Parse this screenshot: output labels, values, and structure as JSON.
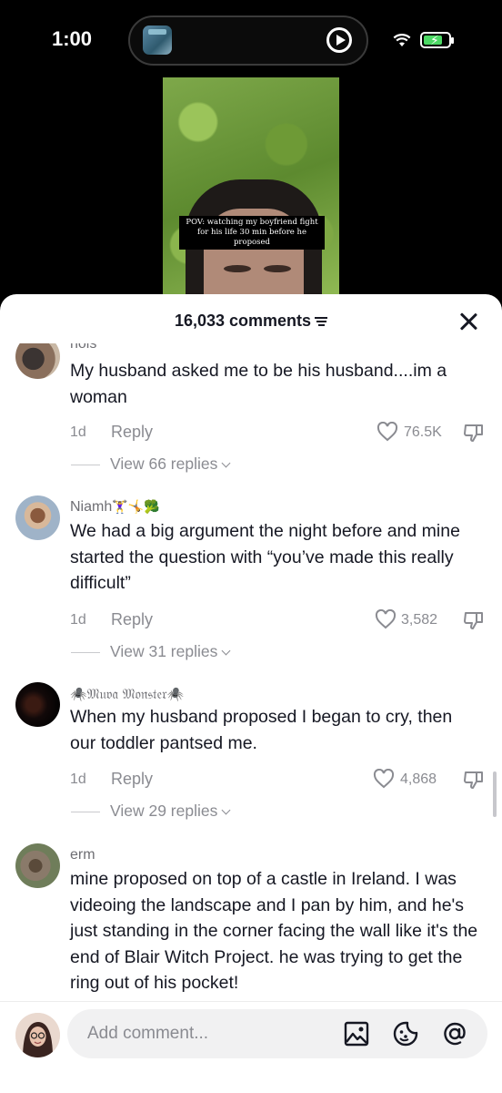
{
  "status_bar": {
    "time": "1:00"
  },
  "video": {
    "caption": "POV: watching my boyfriend fight for his life 30 min before he proposed"
  },
  "comments_panel": {
    "count_label": "16,033 comments",
    "comments": [
      {
        "username": "nols",
        "text": "My husband asked me to be his husband....im a woman",
        "date": "1d",
        "reply_label": "Reply",
        "likes": "76.5K",
        "view_replies": "View 66 replies"
      },
      {
        "username": "Niamh",
        "username_emoji": "🏋️‍♀️🤸🥦",
        "text": "We had a big argument the night before and mine started the question with “you’ve made this really difficult”",
        "date": "1d",
        "reply_label": "Reply",
        "likes": "3,582",
        "view_replies": "View 31 replies"
      },
      {
        "username": "🕷️𝔐𝔲𝔳𝔞 𝔐𝔬𝔫𝔰𝔱𝔢𝔯🕷️",
        "text": "When my husband proposed I began to cry, then our toddler pantsed me.",
        "date": "1d",
        "reply_label": "Reply",
        "likes": "4,868",
        "view_replies": "View 29 replies"
      },
      {
        "username": "erm",
        "text": "mine proposed on top of a castle in Ireland. I was videoing the landscape and I pan by him, and he's just standing in the corner facing the wall like it's the end of Blair Witch Project. he was trying to get the ring out of his pocket!"
      }
    ]
  },
  "composer": {
    "placeholder": "Add comment..."
  },
  "colors": {
    "text": "#161823",
    "muted": "#8a8b91",
    "sheet": "#ffffff"
  }
}
